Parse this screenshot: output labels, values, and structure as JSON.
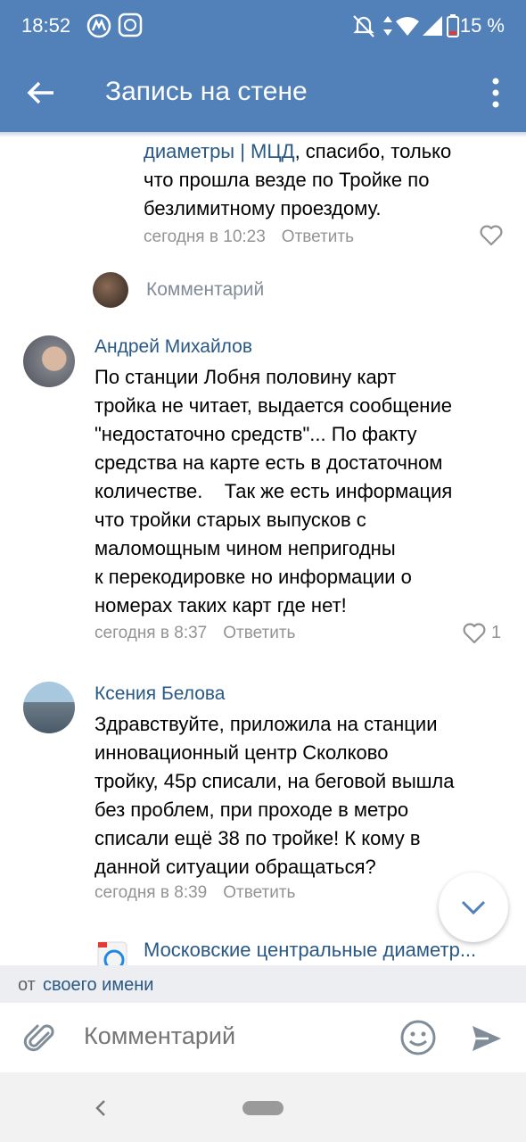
{
  "status_bar": {
    "time": "18:52",
    "battery": "15 %"
  },
  "app_bar": {
    "title": "Запись на стене"
  },
  "top_comment": {
    "link_text": "диаметры | МЦД",
    "text_after_link": ", спасибо, только",
    "lines": [
      "что прошла везде по Тройке по",
      "безлимитному проездому."
    ],
    "time": "сегодня в 10:23",
    "reply": "Ответить"
  },
  "reply_prompt": {
    "placeholder": "Комментарий"
  },
  "comments": [
    {
      "author": "Андрей Михайлов",
      "lines": [
        "По станции Лобня половину карт",
        "тройка не читает, выдается сообщение",
        "\"недостаточно средств\"... По факту",
        "средства на карте есть в достаточном",
        "количестве.    Так же есть информация",
        "что тройки старых выпусков с",
        "маломощным чином непригодны",
        "к перекодировке но информации о",
        "номерах таких карт где нет!"
      ],
      "time": "сегодня в 8:37",
      "reply": "Ответить",
      "likes": "1"
    },
    {
      "author": "Ксения Белова",
      "lines": [
        "Здравствуйте, приложила на станции",
        "инновационный центр Сколково",
        "тройку, 45р списали, на беговой вышла",
        "без проблем, при проходе в метро",
        "списали ещё 38 по тройке! К кому в",
        "данной ситуации обращаться?"
      ],
      "time": "сегодня в 8:39",
      "reply": "Ответить"
    }
  ],
  "next_comment": {
    "author": "Московские центральные диаметр..."
  },
  "from_row": {
    "prefix": "от",
    "identity": "своего имени"
  },
  "composer": {
    "placeholder": "Комментарий"
  },
  "colors": {
    "brand": "#5181b8",
    "link": "#2a5885",
    "meta": "#939393"
  },
  "icons": [
    "back-arrow-icon",
    "more-vertical-icon",
    "heart-icon",
    "chevron-down-icon",
    "paperclip-icon",
    "emoji-icon",
    "send-icon",
    "nav-back-icon"
  ]
}
